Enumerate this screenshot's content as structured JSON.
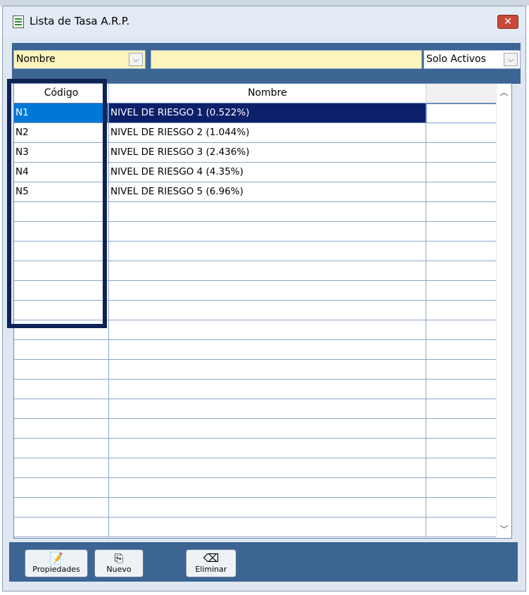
{
  "window": {
    "title": "Lista de Tasa A.R.P.",
    "close_label": "✕"
  },
  "filter": {
    "field_value": "Nombre",
    "search_value": "",
    "status_value": "Solo Activos"
  },
  "table": {
    "columns": [
      "Código",
      "Nombre",
      ""
    ],
    "rows": [
      {
        "codigo": "N1",
        "nombre": "NIVEL DE RIESGO 1 (0.522%)"
      },
      {
        "codigo": "N2",
        "nombre": "NIVEL DE RIESGO 2 (1.044%)"
      },
      {
        "codigo": "N3",
        "nombre": "NIVEL DE RIESGO 3 (2.436%)"
      },
      {
        "codigo": "N4",
        "nombre": "NIVEL DE RIESGO 4 (4.35%)"
      },
      {
        "codigo": "N5",
        "nombre": "NIVEL DE RIESGO 5 (6.96%)"
      }
    ],
    "selected_row": 0
  },
  "toolbar": {
    "properties_label": "Propiedades",
    "new_label": "Nuevo",
    "delete_label": "Eliminar"
  },
  "icons": {
    "app": "spreadsheet-icon",
    "properties": "edit-document-icon",
    "new": "new-document-icon",
    "delete": "eraser-icon"
  },
  "colors": {
    "accent_bar": "#3c6594",
    "input_bg": "#fdf3bc",
    "selected_row": "#0b1f6b",
    "selected_code": "#0078d7",
    "highlight_box": "#0f2255",
    "close_button": "#c9483a"
  }
}
